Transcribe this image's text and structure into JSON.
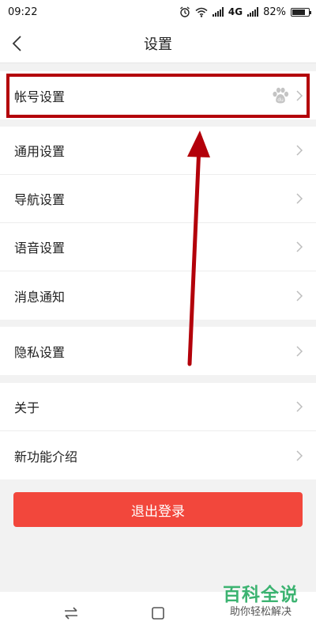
{
  "status_bar": {
    "time": "09:22",
    "network": "4G",
    "battery": "82%",
    "battery_level": 0.82
  },
  "header": {
    "title": "设置",
    "back_icon": "chevron-left-icon"
  },
  "groups": [
    {
      "items": [
        {
          "label": "帐号设置",
          "badge_icon": "baidu-paw-icon",
          "highlighted": true
        }
      ]
    },
    {
      "items": [
        {
          "label": "通用设置"
        },
        {
          "label": "导航设置"
        },
        {
          "label": "语音设置"
        },
        {
          "label": "消息通知"
        }
      ]
    },
    {
      "items": [
        {
          "label": "隐私设置"
        }
      ]
    },
    {
      "items": [
        {
          "label": "关于"
        },
        {
          "label": "新功能介绍"
        }
      ]
    }
  ],
  "logout": {
    "label": "退出登录",
    "color": "#f2473c"
  },
  "annotation": {
    "box_color": "#b3000a",
    "arrow_color": "#b3000a"
  },
  "nav_bar": {
    "icons": [
      "switch-apps-icon",
      "home-square-icon"
    ]
  },
  "watermark": {
    "main": "百科全说",
    "sub": "助你轻松解决",
    "color": "#3cb371"
  }
}
